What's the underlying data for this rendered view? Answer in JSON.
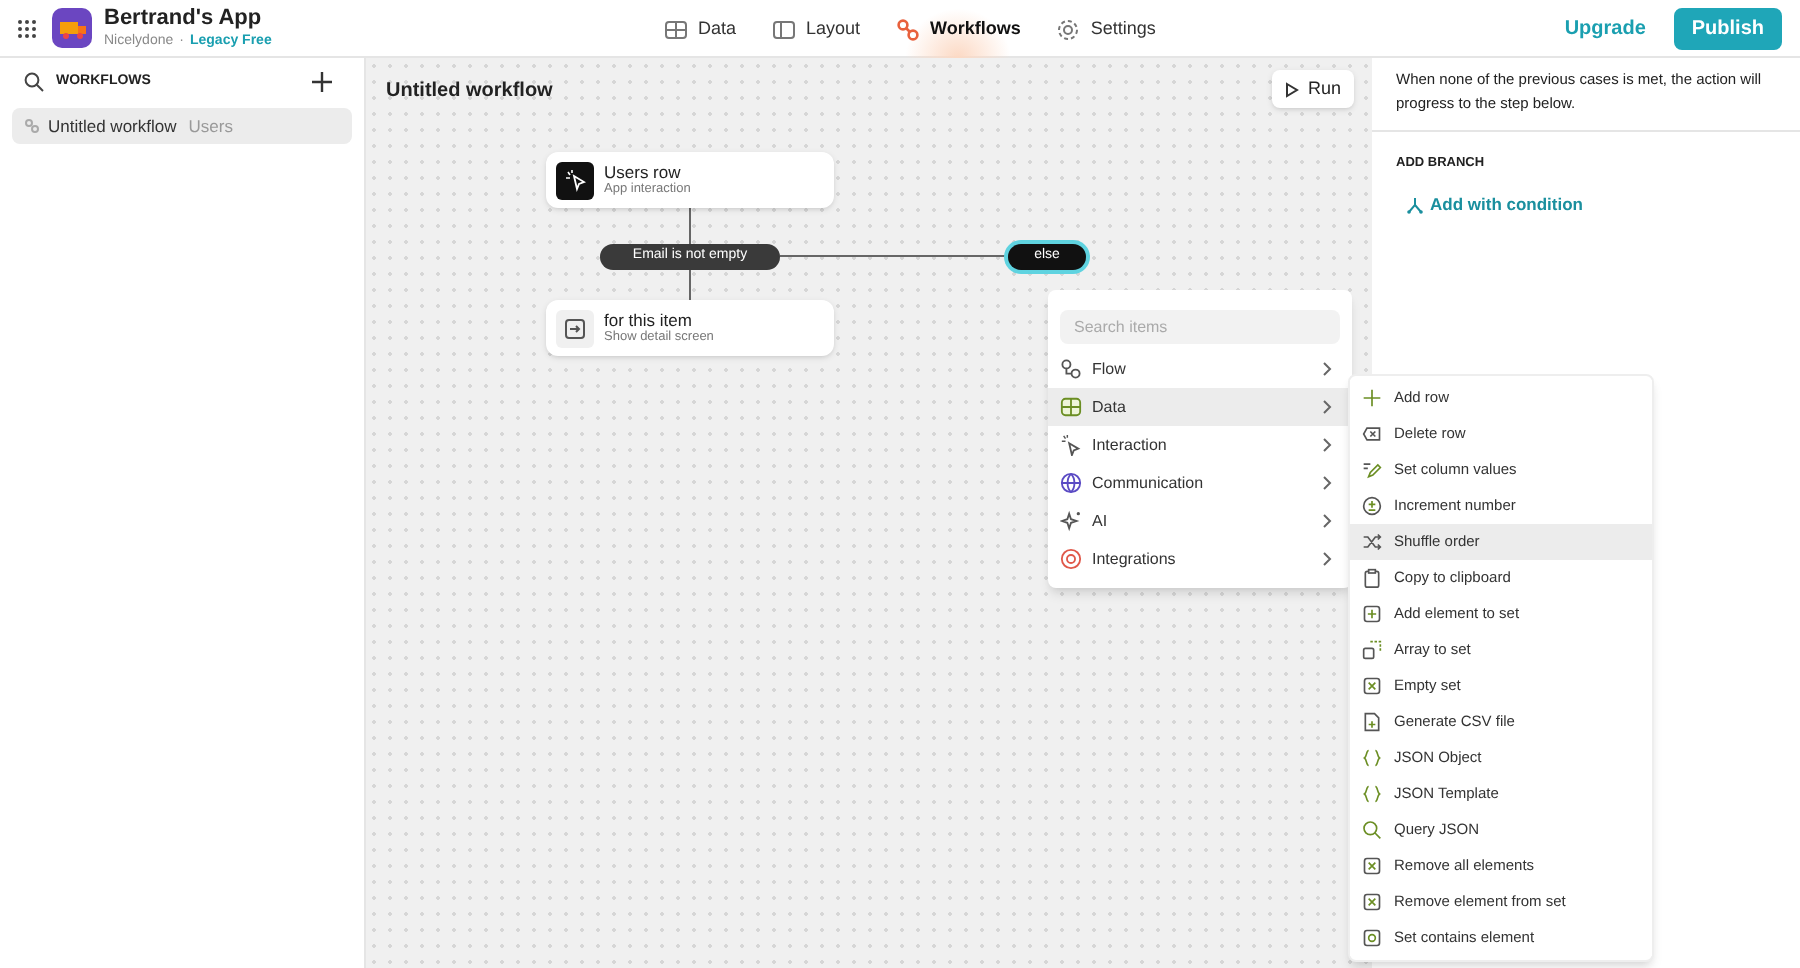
{
  "app": {
    "name": "Bertrand's App",
    "org": "Nicelydone",
    "separator": "·",
    "plan": "Legacy Free"
  },
  "nav": [
    {
      "label": "Data",
      "selected": false
    },
    {
      "label": "Layout",
      "selected": false
    },
    {
      "label": "Workflows",
      "selected": true
    },
    {
      "label": "Settings",
      "selected": false
    }
  ],
  "actions": {
    "upgrade": "Upgrade",
    "publish": "Publish"
  },
  "sidebar": {
    "title": "WORKFLOWS",
    "items": [
      {
        "name": "Untitled workflow",
        "table": "Users",
        "selected": true
      }
    ]
  },
  "canvas": {
    "title": "Untitled workflow",
    "run": "Run",
    "nodes": [
      {
        "title": "Users row",
        "subtitle": "App interaction",
        "kind": "trigger"
      },
      {
        "title": "for this item",
        "subtitle": "Show detail screen",
        "kind": "action"
      }
    ],
    "condition": "Email is not empty",
    "else": "else"
  },
  "menu": {
    "placeholder": "Search items",
    "items": [
      {
        "label": "Flow",
        "highlighted": false
      },
      {
        "label": "Data",
        "highlighted": true
      },
      {
        "label": "Interaction",
        "highlighted": false
      },
      {
        "label": "Communication",
        "highlighted": false
      },
      {
        "label": "AI",
        "highlighted": false
      },
      {
        "label": "Integrations",
        "highlighted": false
      }
    ]
  },
  "submenu": {
    "items": [
      {
        "label": "Add row",
        "highlighted": false
      },
      {
        "label": "Delete row",
        "highlighted": false
      },
      {
        "label": "Set column values",
        "highlighted": false
      },
      {
        "label": "Increment number",
        "highlighted": false
      },
      {
        "label": "Shuffle order",
        "highlighted": true
      },
      {
        "label": "Copy to clipboard",
        "highlighted": false
      },
      {
        "label": "Add element to set",
        "highlighted": false
      },
      {
        "label": "Array to set",
        "highlighted": false
      },
      {
        "label": "Empty set",
        "highlighted": false
      },
      {
        "label": "Generate CSV file",
        "highlighted": false
      },
      {
        "label": "JSON Object",
        "highlighted": false
      },
      {
        "label": "JSON Template",
        "highlighted": false
      },
      {
        "label": "Query JSON",
        "highlighted": false
      },
      {
        "label": "Remove all elements",
        "highlighted": false
      },
      {
        "label": "Remove element from set",
        "highlighted": false
      },
      {
        "label": "Set contains element",
        "highlighted": false
      }
    ]
  },
  "panel": {
    "description": "When none of the previous cases is met, the action will progress to the step below.",
    "section": "ADD BRANCH",
    "add_condition": "Add with condition"
  }
}
